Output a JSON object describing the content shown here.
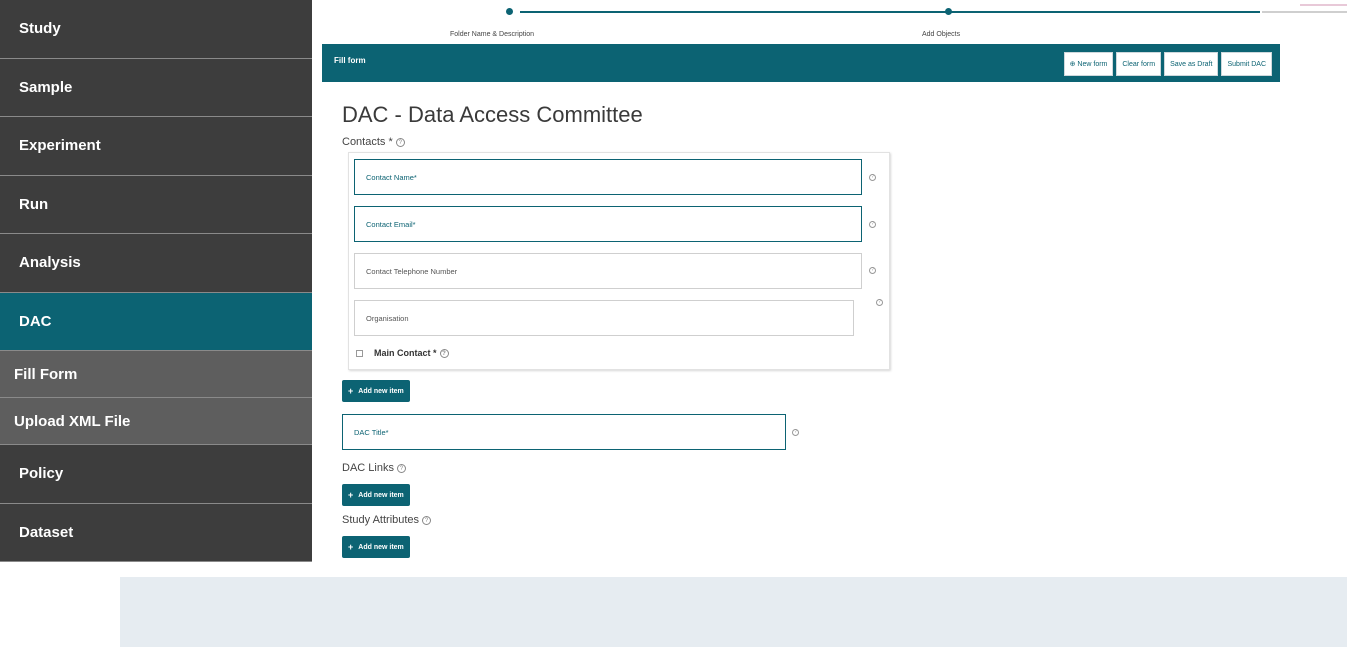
{
  "sidebar": {
    "items": [
      {
        "label": "Study"
      },
      {
        "label": "Sample"
      },
      {
        "label": "Experiment"
      },
      {
        "label": "Run"
      },
      {
        "label": "Analysis"
      },
      {
        "label": "DAC"
      }
    ],
    "sub_items": [
      {
        "label": "Fill Form"
      },
      {
        "label": "Upload XML File"
      }
    ],
    "items_after": [
      {
        "label": "Policy"
      },
      {
        "label": "Dataset"
      }
    ]
  },
  "stepper": {
    "step1": "Folder Name & Description",
    "step2": "Add Objects"
  },
  "toolbar": {
    "title": "Fill form",
    "new_form": "⊕ New form",
    "clear_form": "Clear form",
    "save_draft": "Save as Draft",
    "submit": "Submit DAC"
  },
  "form": {
    "title": "DAC - Data Access Committee",
    "contacts_label": "Contacts *",
    "contact_name": "Contact Name*",
    "contact_email": "Contact Email*",
    "contact_phone": "Contact Telephone Number",
    "organisation": "Organisation",
    "main_contact": "Main Contact *",
    "add_item": "Add new item",
    "dac_title": "DAC Title*",
    "dac_links_label": "DAC Links",
    "study_attributes_label": "Study Attributes"
  },
  "colors": {
    "accent": "#0c6373",
    "sidebar_bg": "#3d3d3d",
    "sidebar_sub_bg": "#5e5e5e"
  }
}
